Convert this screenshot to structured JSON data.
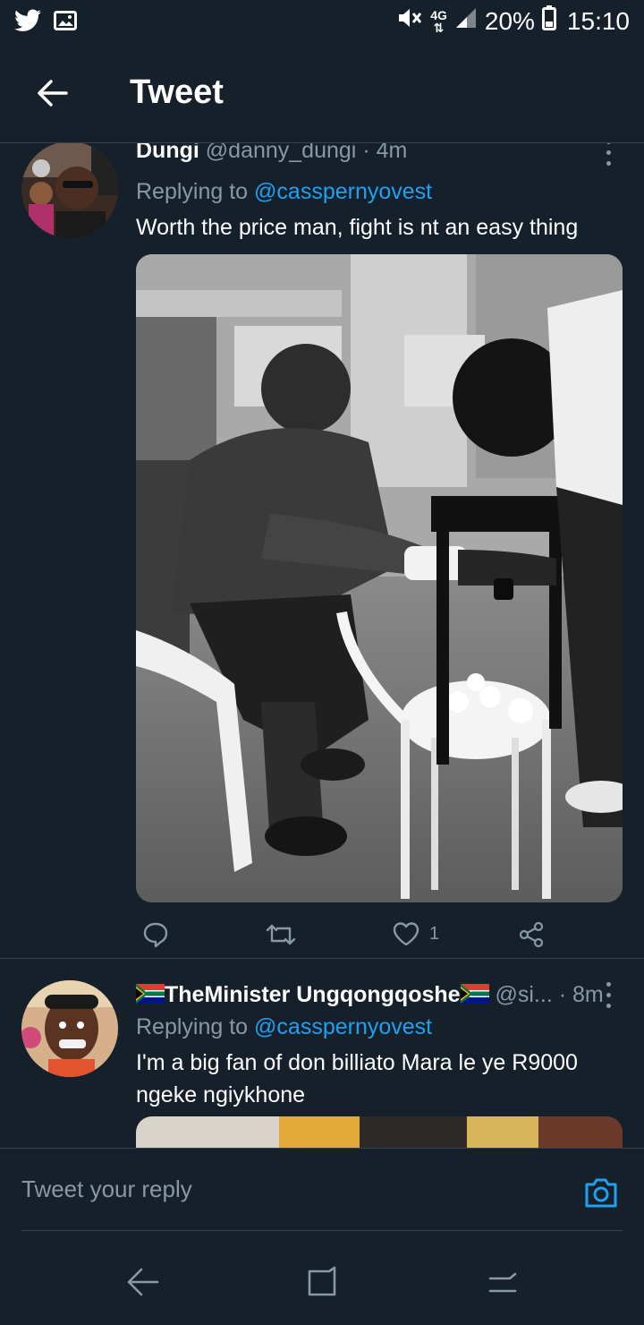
{
  "status_bar": {
    "icons_left": [
      "twitter-icon",
      "image-icon"
    ],
    "icons_right": [
      "mute-icon",
      "network-4g-icon",
      "signal-icon"
    ],
    "network": "4G",
    "battery": "20%",
    "time": "15:10"
  },
  "header": {
    "title": "Tweet",
    "back_icon": "arrow-left-icon"
  },
  "tweets": [
    {
      "name": "Dungi",
      "handle": "@danny_dungi",
      "time": "· 4m",
      "replying_prefix": "Replying to ",
      "replying_to": "@casspernyovest",
      "text": "Worth the price man, fight is nt an easy thing",
      "media": "photo-black-and-white",
      "actions": {
        "reply_icon": "reply-icon",
        "retweet_icon": "retweet-icon",
        "like_icon": "heart-icon",
        "like_count": "1",
        "share_icon": "share-icon"
      }
    },
    {
      "name": "TheMinister Ungqongqoshe",
      "handle": "@si...",
      "time": "· 8m",
      "replying_prefix": "Replying to ",
      "replying_to": "@casspernyovest",
      "text": "I'm a big fan of don billiato Mara le ye R9000 ngeke ngiykhone",
      "media": "photo-partial"
    }
  ],
  "reply_bar": {
    "placeholder": "Tweet your reply",
    "camera_icon": "camera-icon"
  },
  "nav_bar": {
    "back_icon": "nav-back-icon",
    "recents_icon": "nav-recents-icon",
    "home_icon": "nav-home-icon"
  },
  "colors": {
    "background": "#15202b",
    "accent": "#1da1f2",
    "secondary_text": "#8899a6",
    "divider": "#38444d"
  }
}
